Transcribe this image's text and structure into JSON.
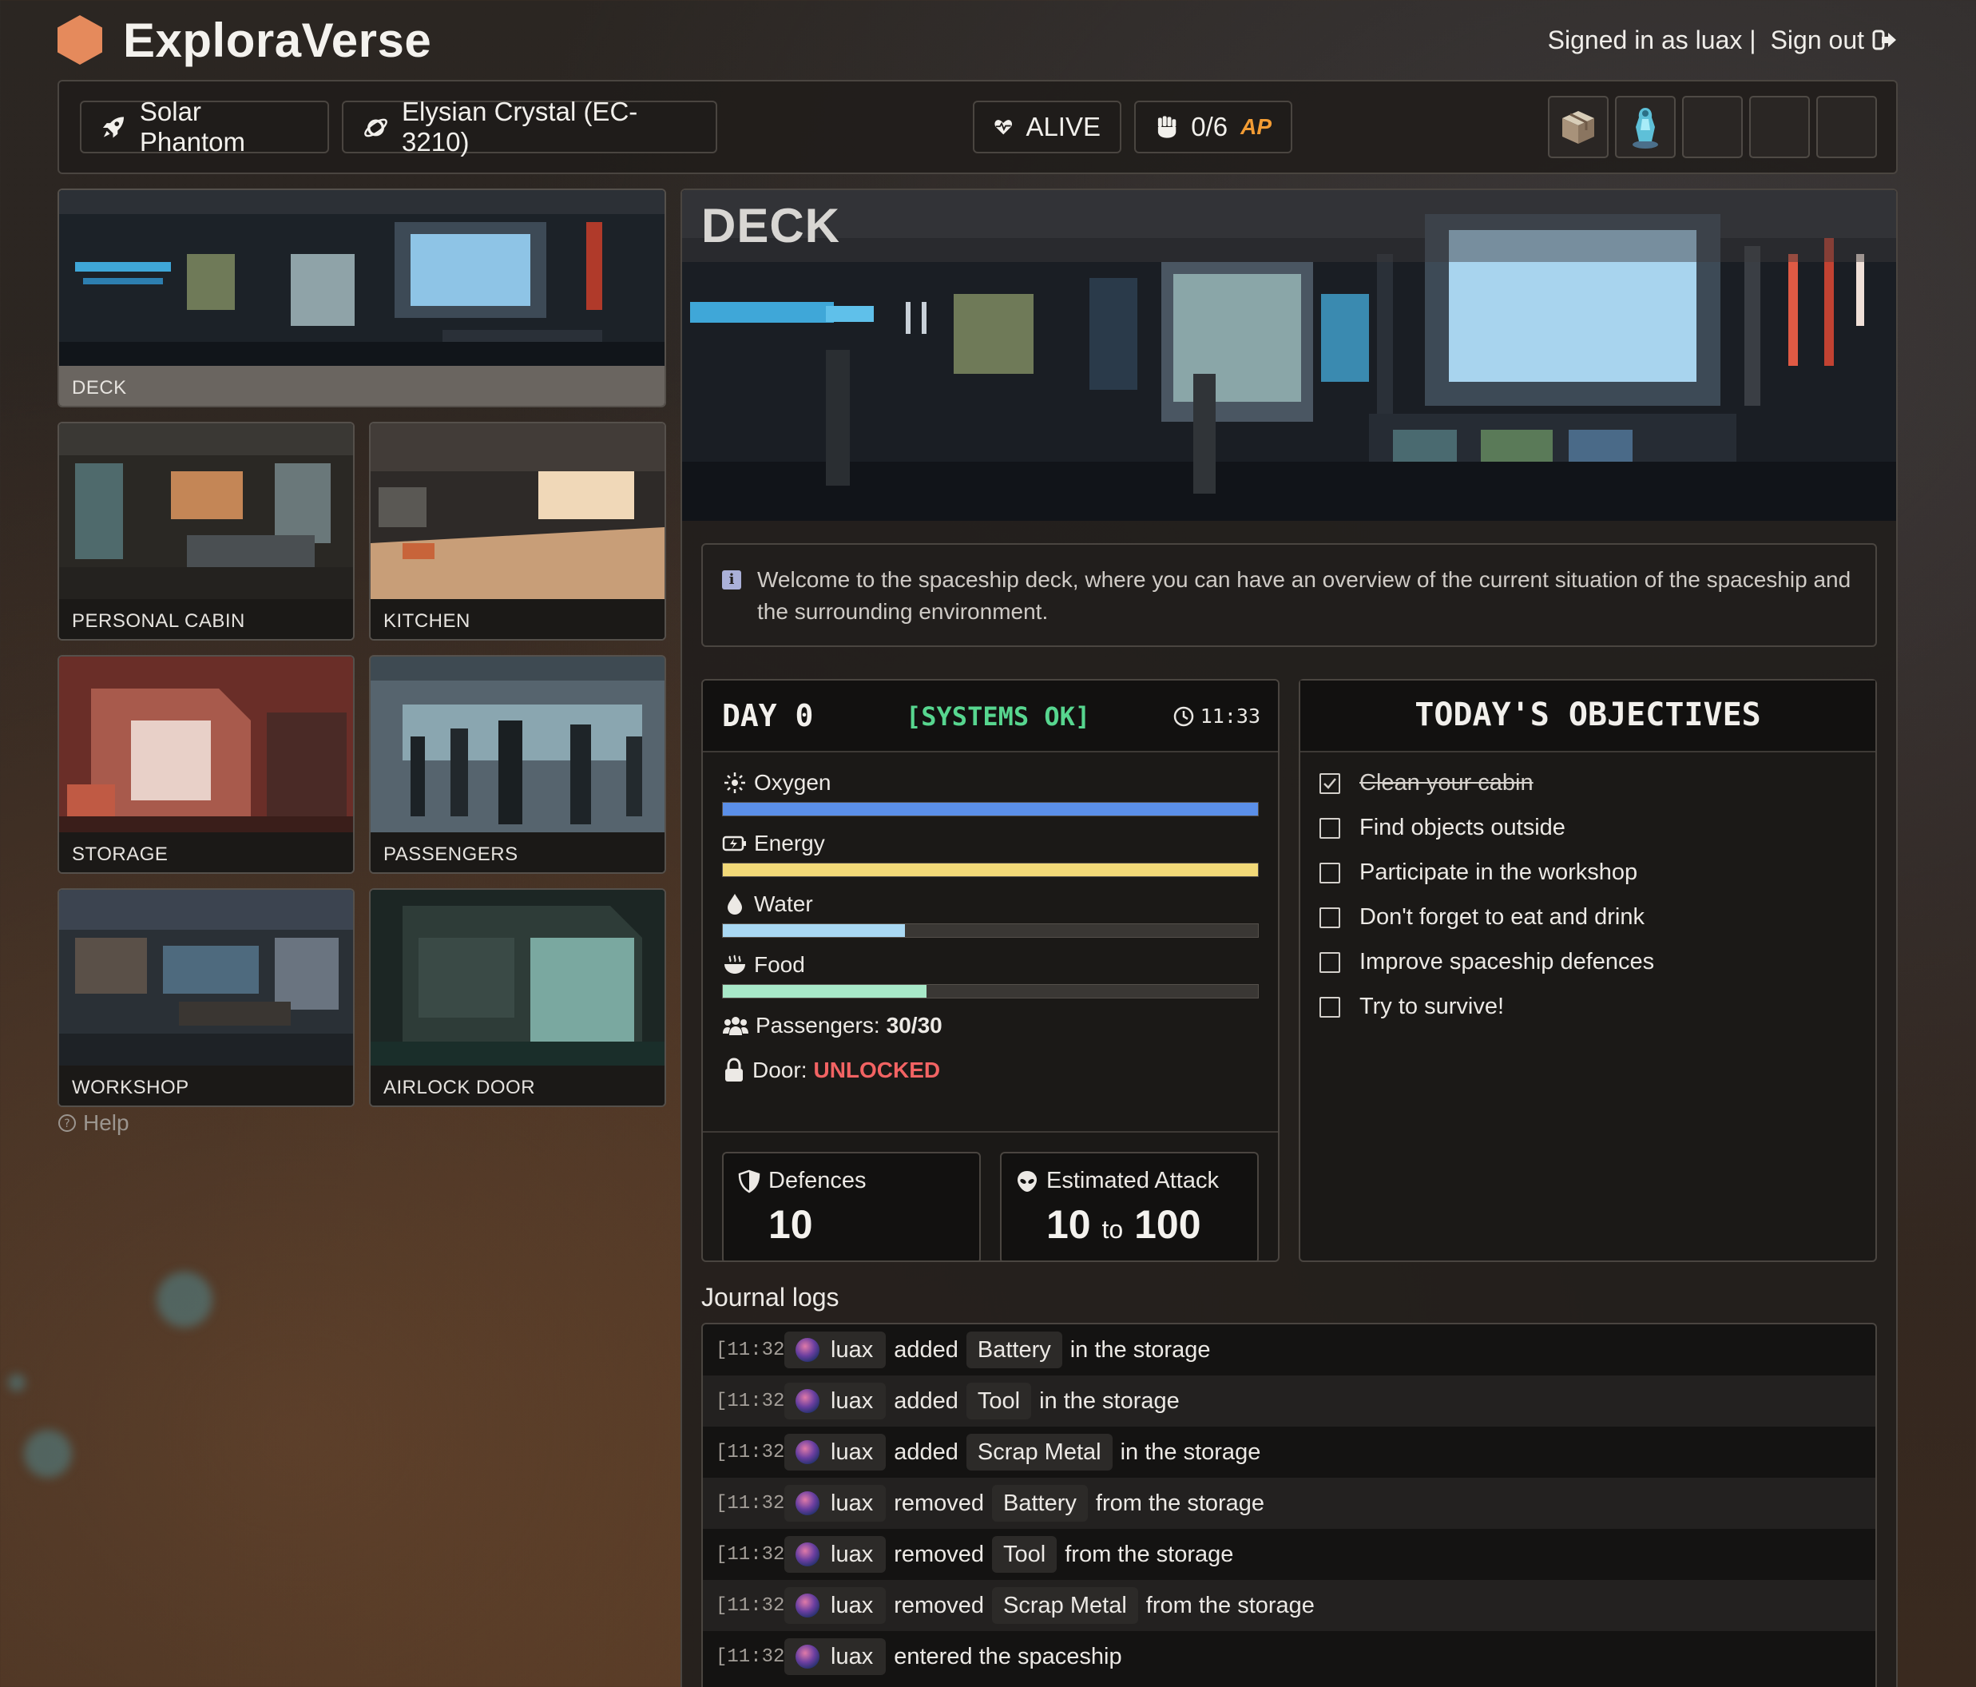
{
  "app": {
    "title": "ExploraVerse",
    "signed_in_text": "Signed in as luax |",
    "sign_out_label": "Sign out"
  },
  "toolbar": {
    "ship_name": "Solar Phantom",
    "planet_name": "Elysian Crystal (EC-3210)",
    "status": "ALIVE",
    "action_points": "0/6",
    "ap_label": "AP",
    "inventory_slots": [
      {
        "icon": "supply-crate-icon",
        "filled": true
      },
      {
        "icon": "crystal-figurine-icon",
        "filled": true
      },
      {
        "icon": "empty-slot",
        "filled": false
      },
      {
        "icon": "empty-slot",
        "filled": false
      },
      {
        "icon": "empty-slot",
        "filled": false
      }
    ]
  },
  "rooms": [
    {
      "label": "DECK",
      "active": true
    },
    {
      "label": "PERSONAL CABIN",
      "active": false
    },
    {
      "label": "KITCHEN",
      "active": false
    },
    {
      "label": "STORAGE",
      "active": false
    },
    {
      "label": "PASSENGERS",
      "active": false
    },
    {
      "label": "WORKSHOP",
      "active": false
    },
    {
      "label": "AIRLOCK DOOR",
      "active": false
    }
  ],
  "help_label": "Help",
  "room_view": {
    "title": "DECK",
    "description": "Welcome to the spaceship deck, where you can have an overview of the current situation of the spaceship and the surrounding environment."
  },
  "status_panel": {
    "day_label": "DAY 0",
    "systems_label": "[SYSTEMS OK]",
    "time": "11:33",
    "resources": [
      {
        "name": "Oxygen",
        "icon": "oxygen-icon",
        "level": 1.0,
        "color": "#5b8fe8"
      },
      {
        "name": "Energy",
        "icon": "battery-icon",
        "level": 1.0,
        "color": "#f2d978"
      },
      {
        "name": "Water",
        "icon": "water-drop-icon",
        "level": 0.34,
        "color": "#a9d8f3"
      },
      {
        "name": "Food",
        "icon": "food-bowl-icon",
        "level": 0.38,
        "color": "#a8e8c8"
      }
    ],
    "passengers_label": "Passengers:",
    "passengers_value": "30/30",
    "door_label": "Door:",
    "door_value": "UNLOCKED",
    "defences_label": "Defences",
    "defences_value": "10",
    "attack_label": "Estimated Attack",
    "attack_min": "10",
    "attack_to": "to",
    "attack_max": "100"
  },
  "objectives": {
    "title": "TODAY'S OBJECTIVES",
    "items": [
      {
        "text": "Clean your cabin",
        "done": true
      },
      {
        "text": "Find objects outside",
        "done": false
      },
      {
        "text": "Participate in the workshop",
        "done": false
      },
      {
        "text": "Don't forget to eat and drink",
        "done": false
      },
      {
        "text": "Improve spaceship defences",
        "done": false
      },
      {
        "text": "Try to survive!",
        "done": false
      }
    ]
  },
  "journal": {
    "title": "Journal logs",
    "entries": [
      {
        "time": "[11:32]",
        "user": "luax",
        "action": "added",
        "item": "Battery",
        "suffix": "in the storage"
      },
      {
        "time": "[11:32]",
        "user": "luax",
        "action": "added",
        "item": "Tool",
        "suffix": "in the storage"
      },
      {
        "time": "[11:32]",
        "user": "luax",
        "action": "added",
        "item": "Scrap Metal",
        "suffix": "in the storage"
      },
      {
        "time": "[11:32]",
        "user": "luax",
        "action": "removed",
        "item": "Battery",
        "suffix": "from the storage"
      },
      {
        "time": "[11:32]",
        "user": "luax",
        "action": "removed",
        "item": "Tool",
        "suffix": "from the storage"
      },
      {
        "time": "[11:32]",
        "user": "luax",
        "action": "removed",
        "item": "Scrap Metal",
        "suffix": "from the storage"
      },
      {
        "time": "[11:32]",
        "user": "luax",
        "action": "entered the spaceship",
        "item": "",
        "suffix": ""
      }
    ]
  }
}
